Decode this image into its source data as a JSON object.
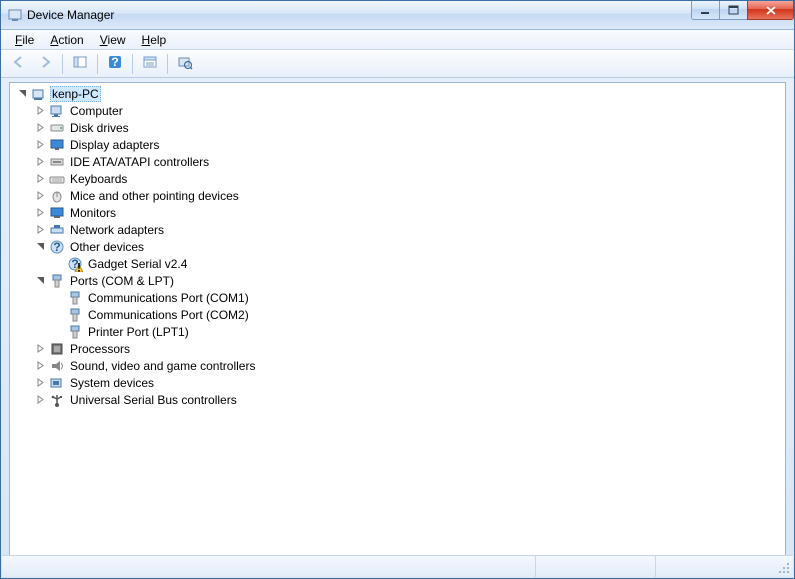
{
  "window": {
    "title": "Device Manager"
  },
  "menu": {
    "file": "File",
    "action": "Action",
    "view": "View",
    "help": "Help"
  },
  "toolbar": {
    "back": "Back",
    "forward": "Forward",
    "show_hide": "Show/Hide Console Tree",
    "help": "Help",
    "properties": "Properties",
    "scan": "Scan for hardware changes"
  },
  "tree": {
    "root": "kenp-PC",
    "nodes": [
      {
        "label": "Computer",
        "icon": "computer",
        "expandable": true
      },
      {
        "label": "Disk drives",
        "icon": "disk",
        "expandable": true
      },
      {
        "label": "Display adapters",
        "icon": "display",
        "expandable": true
      },
      {
        "label": "IDE ATA/ATAPI controllers",
        "icon": "ide",
        "expandable": true
      },
      {
        "label": "Keyboards",
        "icon": "keyboard",
        "expandable": true
      },
      {
        "label": "Mice and other pointing devices",
        "icon": "mouse",
        "expandable": true
      },
      {
        "label": "Monitors",
        "icon": "monitor",
        "expandable": true
      },
      {
        "label": "Network adapters",
        "icon": "network",
        "expandable": true
      },
      {
        "label": "Other devices",
        "icon": "other",
        "expandable": true,
        "expanded": true,
        "children": [
          {
            "label": "Gadget Serial v2.4",
            "icon": "warning"
          }
        ]
      },
      {
        "label": "Ports (COM & LPT)",
        "icon": "port",
        "expandable": true,
        "expanded": true,
        "children": [
          {
            "label": "Communications Port (COM1)",
            "icon": "port"
          },
          {
            "label": "Communications Port (COM2)",
            "icon": "port"
          },
          {
            "label": "Printer Port (LPT1)",
            "icon": "port"
          }
        ]
      },
      {
        "label": "Processors",
        "icon": "cpu",
        "expandable": true
      },
      {
        "label": "Sound, video and game controllers",
        "icon": "sound",
        "expandable": true
      },
      {
        "label": "System devices",
        "icon": "system",
        "expandable": true
      },
      {
        "label": "Universal Serial Bus controllers",
        "icon": "usb",
        "expandable": true
      }
    ]
  }
}
